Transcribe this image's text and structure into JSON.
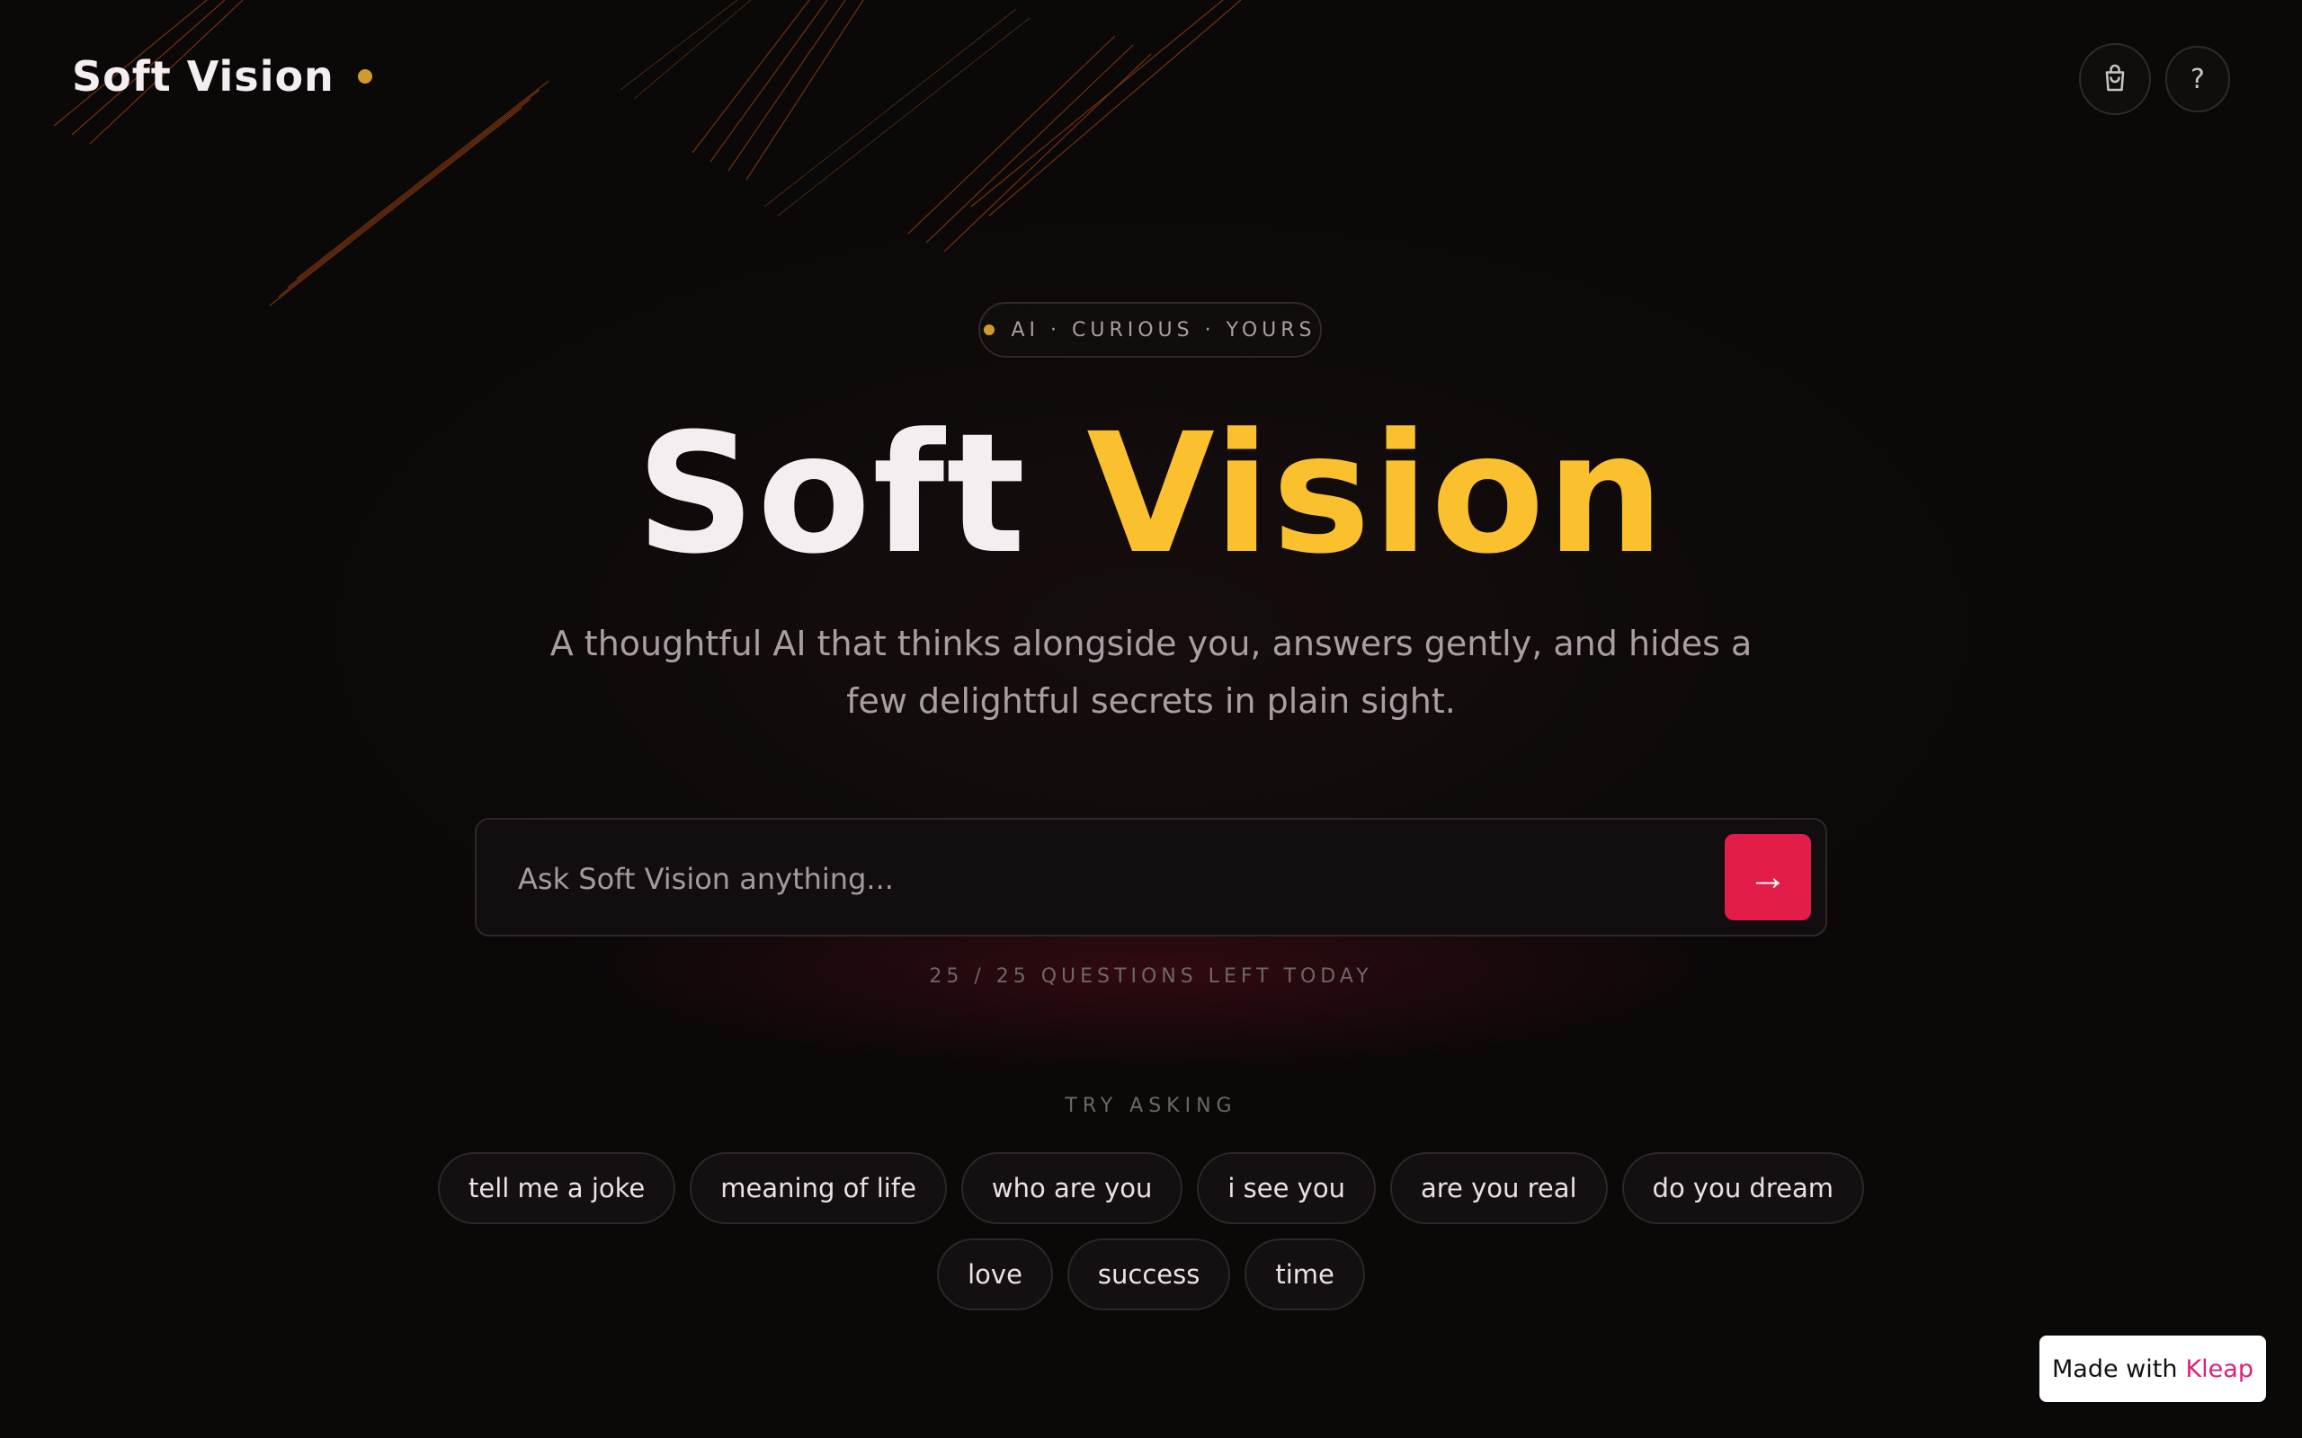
{
  "header": {
    "brand": "Soft Vision",
    "cart_icon": "shopping-bag-icon",
    "help_label": "?"
  },
  "hero": {
    "badge": "AI · CURIOUS · YOURS",
    "title_part1": "Soft",
    "title_part2": "Vision",
    "subtitle": "A thoughtful AI that thinks alongside you, answers gently, and hides a few delightful secrets in plain sight."
  },
  "search": {
    "placeholder": "Ask Soft Vision anything...",
    "value": "",
    "send_label": "→"
  },
  "quota": "25 / 25 QUESTIONS LEFT TODAY",
  "suggestions": {
    "label": "TRY ASKING",
    "items": [
      "tell me a joke",
      "meaning of life",
      "who are you",
      "i see you",
      "are you real",
      "do you dream",
      "love",
      "success",
      "time"
    ]
  },
  "footer_badge": {
    "prefix": "Made with",
    "brand": "Kleap"
  },
  "colors": {
    "accent_yellow": "#fbc02d",
    "accent_gold_dot": "#d19a2e",
    "send_button": "#e11d48",
    "background": "#0b0808",
    "kleap_pink": "#e11d74"
  }
}
